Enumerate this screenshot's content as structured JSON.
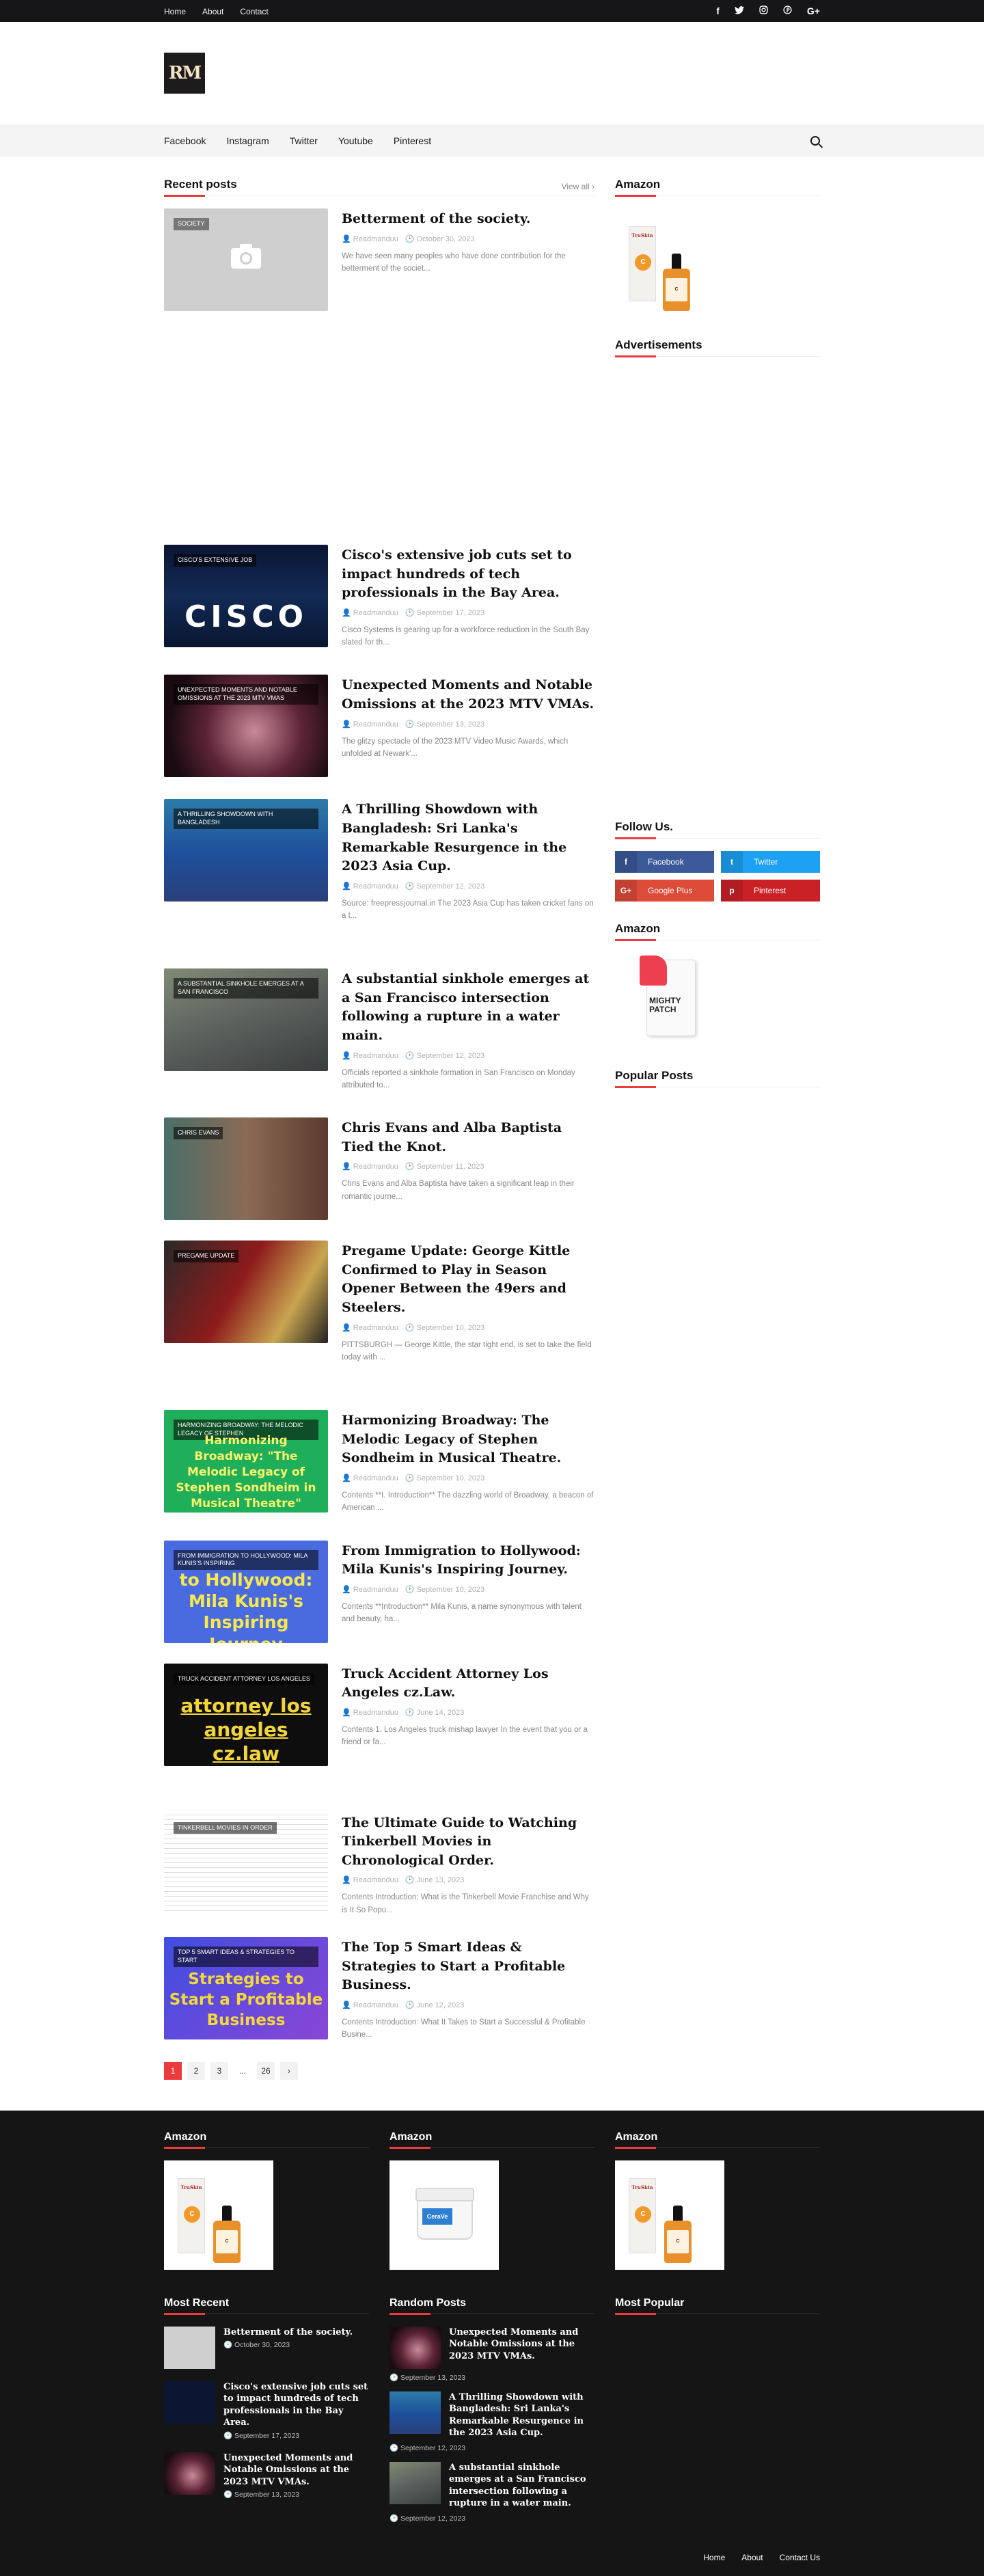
{
  "topbar": {
    "links": [
      "Home",
      "About",
      "Contact"
    ],
    "social": [
      "facebook-icon",
      "twitter-icon",
      "instagram-icon",
      "pinterest-icon",
      "google-plus-icon"
    ]
  },
  "logo_text": "RM",
  "nav": {
    "items": [
      "Facebook",
      "Instagram",
      "Twitter",
      "Youtube",
      "Pinterest"
    ]
  },
  "recent": {
    "title": "Recent posts",
    "view_all": "View all ›",
    "posts": [
      {
        "tag": "SOCIETY",
        "title": "Betterment of the society.",
        "author": "Readmanduu",
        "date": "October 30, 2023",
        "excerpt": "We have seen many peoples who have done contribution for the betterment of the societ..."
      },
      {
        "tag": "CISCO'S EXTENSIVE JOB",
        "title": "Cisco's extensive job cuts set to impact hundreds of tech professionals in the Bay Area.",
        "author": "Readmanduu",
        "date": "September 17, 2023",
        "excerpt": "Cisco Systems is gearing up for a workforce reduction in the South Bay slated for th...",
        "big": "CISCO"
      },
      {
        "tag": "UNEXPECTED MOMENTS AND NOTABLE OMISSIONS AT THE 2023 MTV VMAS",
        "title": "Unexpected Moments and Notable Omissions at the 2023 MTV VMAs.",
        "author": "Readmanduu",
        "date": "September 13, 2023",
        "excerpt": "The glitzy spectacle of the 2023 MTV Video Music Awards, which unfolded at Newark'..."
      },
      {
        "tag": "A THRILLING SHOWDOWN WITH BANGLADESH",
        "title": "A Thrilling Showdown with Bangladesh: Sri Lanka's Remarkable Resurgence in the 2023 Asia Cup.",
        "author": "Readmanduu",
        "date": "September 12, 2023",
        "excerpt": "Source: freepressjournal.in      The 2023 Asia Cup has taken cricket fans on a t..."
      },
      {
        "tag": "A SUBSTANTIAL SINKHOLE EMERGES AT A SAN FRANCISCO",
        "title": "A substantial sinkhole emerges at a San Francisco intersection following a rupture in a water main.",
        "author": "Readmanduu",
        "date": "September 12, 2023",
        "excerpt": "Officials reported a sinkhole formation in San Francisco on Monday attributed to..."
      },
      {
        "tag": "CHRIS EVANS",
        "title": "Chris Evans and Alba Baptista Tied the Knot.",
        "author": "Readmanduu",
        "date": "September 11, 2023",
        "excerpt": "Chris Evans and Alba Baptista have taken a significant leap in their romantic journe..."
      },
      {
        "tag": "PREGAME UPDATE",
        "title": "Pregame Update: George Kittle Confirmed to Play in Season Opener Between the 49ers and Steelers.",
        "author": "Readmanduu",
        "date": "September 10, 2023",
        "excerpt": "PITTSBURGH — George Kittle, the star tight end, is set to take the field today with ..."
      },
      {
        "tag": "HARMONIZING BROADWAY: THE MELODIC LEGACY OF STEPHEN",
        "title": "Harmonizing Broadway: The Melodic Legacy of Stephen Sondheim in Musical Theatre.",
        "author": "Readmanduu",
        "date": "September 10, 2023",
        "excerpt": "Contents **I. Introduction** The dazzling world of Broadway, a beacon of American ...",
        "big": "Harmonizing Broadway: \"The Melodic Legacy of Stephen Sondheim in Musical Theatre\""
      },
      {
        "tag": "FROM IMMIGRATION TO HOLLYWOOD: MILA KUNIS'S INSPIRING",
        "title": "From Immigration to Hollywood: Mila Kunis's Inspiring Journey.",
        "author": "Readmanduu",
        "date": "September 10, 2023",
        "excerpt": "Contents **Introduction** Mila Kunis, a name synonymous with talent and beauty, ha...",
        "big": "to Hollywood: Mila Kunis's Inspiring Journey"
      },
      {
        "tag": "TRUCK ACCIDENT ATTORNEY LOS ANGELES",
        "title": "Truck Accident Attorney Los Angeles cz.Law.",
        "author": "Readmanduu",
        "date": "June 14, 2023",
        "excerpt": "Contents 1. Los Angeles truck mishap lawyer In the event that you or a friend or fa...",
        "big": "attorney los angeles cz.law"
      },
      {
        "tag": "TINKERBELL MOVIES IN ORDER",
        "title": "The Ultimate Guide to Watching Tinkerbell Movies in Chronological Order.",
        "author": "Readmanduu",
        "date": "June 13, 2023",
        "excerpt": "Contents Introduction: What is the Tinkerbell Movie Franchise and Why is It So Popu..."
      },
      {
        "tag": "TOP 5 SMART IDEAS & STRATEGIES TO START",
        "title": "The Top 5 Smart Ideas & Strategies to Start a Profitable Business.",
        "author": "Readmanduu",
        "date": "June 12, 2023",
        "excerpt": "Contents Introduction: What It Takes to Start a Successful & Profitable Busine...",
        "big": "Strategies to Start a Profitable Business"
      }
    ]
  },
  "pager": [
    "1",
    "2",
    "3",
    "...",
    "26",
    "›"
  ],
  "sidebar": {
    "amazon_title": "Amazon",
    "ads_title": "Advertisements",
    "follow_title": "Follow Us.",
    "follow": [
      {
        "label": "Facebook",
        "icon": "f",
        "color": "#3b5998"
      },
      {
        "label": "Twitter",
        "icon": "t",
        "color": "#1da1f2"
      },
      {
        "label": "Google Plus",
        "icon": "G+",
        "color": "#dd4b39"
      },
      {
        "label": "Pinterest",
        "icon": "p",
        "color": "#ca2127"
      }
    ],
    "amazon2_title": "Amazon",
    "popular_title": "Popular Posts",
    "truskin_label": "TruSkin",
    "mighty_label": "MIGHTY PATCH"
  },
  "footer": {
    "amazon_titles": [
      "Amazon",
      "Amazon",
      "Amazon"
    ],
    "cerave_label": "CeraVe",
    "most_recent_title": "Most Recent",
    "random_title": "Random Posts",
    "most_popular_title": "Most Popular",
    "most_recent": [
      {
        "title": "Betterment of the society.",
        "date": "October 30, 2023"
      },
      {
        "title": "Cisco's extensive job cuts set to impact hundreds of tech professionals in the Bay Area.",
        "date": "September 17, 2023"
      },
      {
        "title": "Unexpected Moments and Notable Omissions at the 2023 MTV VMAs.",
        "date": "September 13, 2023"
      }
    ],
    "random": [
      {
        "title": "Unexpected Moments and Notable Omissions at the 2023 MTV VMAs.",
        "date": "September 13, 2023"
      },
      {
        "title": "A Thrilling Showdown with Bangladesh: Sri Lanka's Remarkable Resurgence in the 2023 Asia Cup.",
        "date": "September 12, 2023"
      },
      {
        "title": "A substantial sinkhole emerges at a San Francisco intersection following a rupture in a water main.",
        "date": "September 12, 2023"
      }
    ],
    "bottom_links": [
      "Home",
      "About",
      "Contact Us"
    ]
  }
}
